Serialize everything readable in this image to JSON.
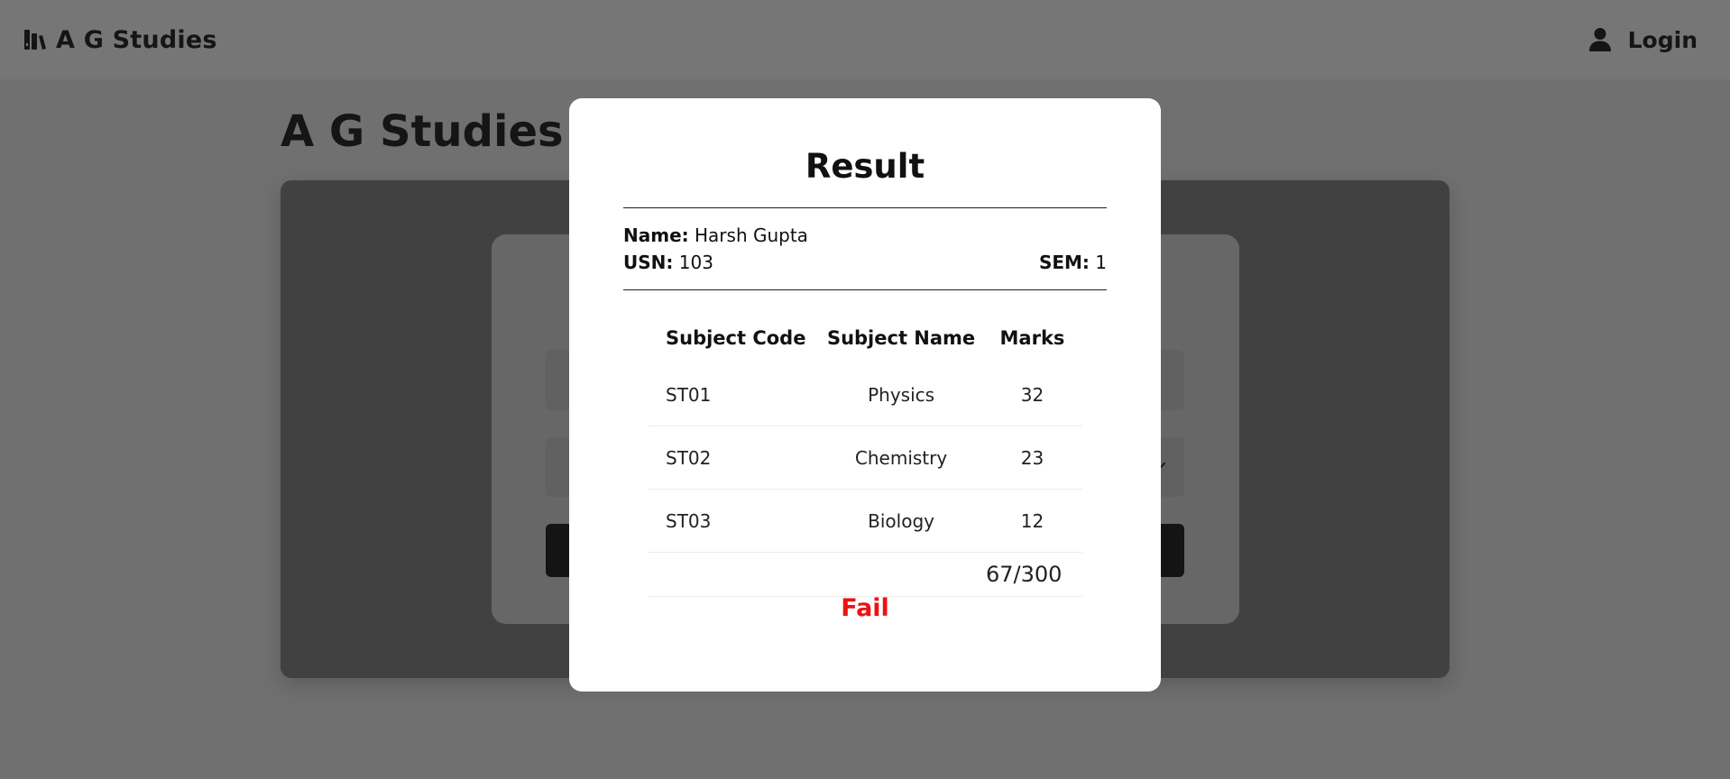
{
  "navbar": {
    "brand_text": "A G Studies",
    "brand_icon": "books-icon",
    "login_text": "Login",
    "login_icon": "user-icon"
  },
  "page": {
    "title": "A G Studies"
  },
  "modal": {
    "title": "Result",
    "name_label": "Name:",
    "name_value": "Harsh Gupta",
    "usn_label": "USN:",
    "usn_value": "103",
    "sem_label": "SEM:",
    "sem_value": "1",
    "table": {
      "headers": [
        "Subject Code",
        "Subject Name",
        "Marks"
      ],
      "rows": [
        {
          "code": "ST01",
          "name": "Physics",
          "marks": "32"
        },
        {
          "code": "ST02",
          "name": "Chemistry",
          "marks": "23"
        },
        {
          "code": "ST03",
          "name": "Biology",
          "marks": "12"
        }
      ],
      "total": "67/300"
    },
    "status": "Fail"
  },
  "colors": {
    "overlay_background": "#707070",
    "modal_background": "#ffffff",
    "fail": "#ee1111",
    "dark_button": "#141414"
  }
}
